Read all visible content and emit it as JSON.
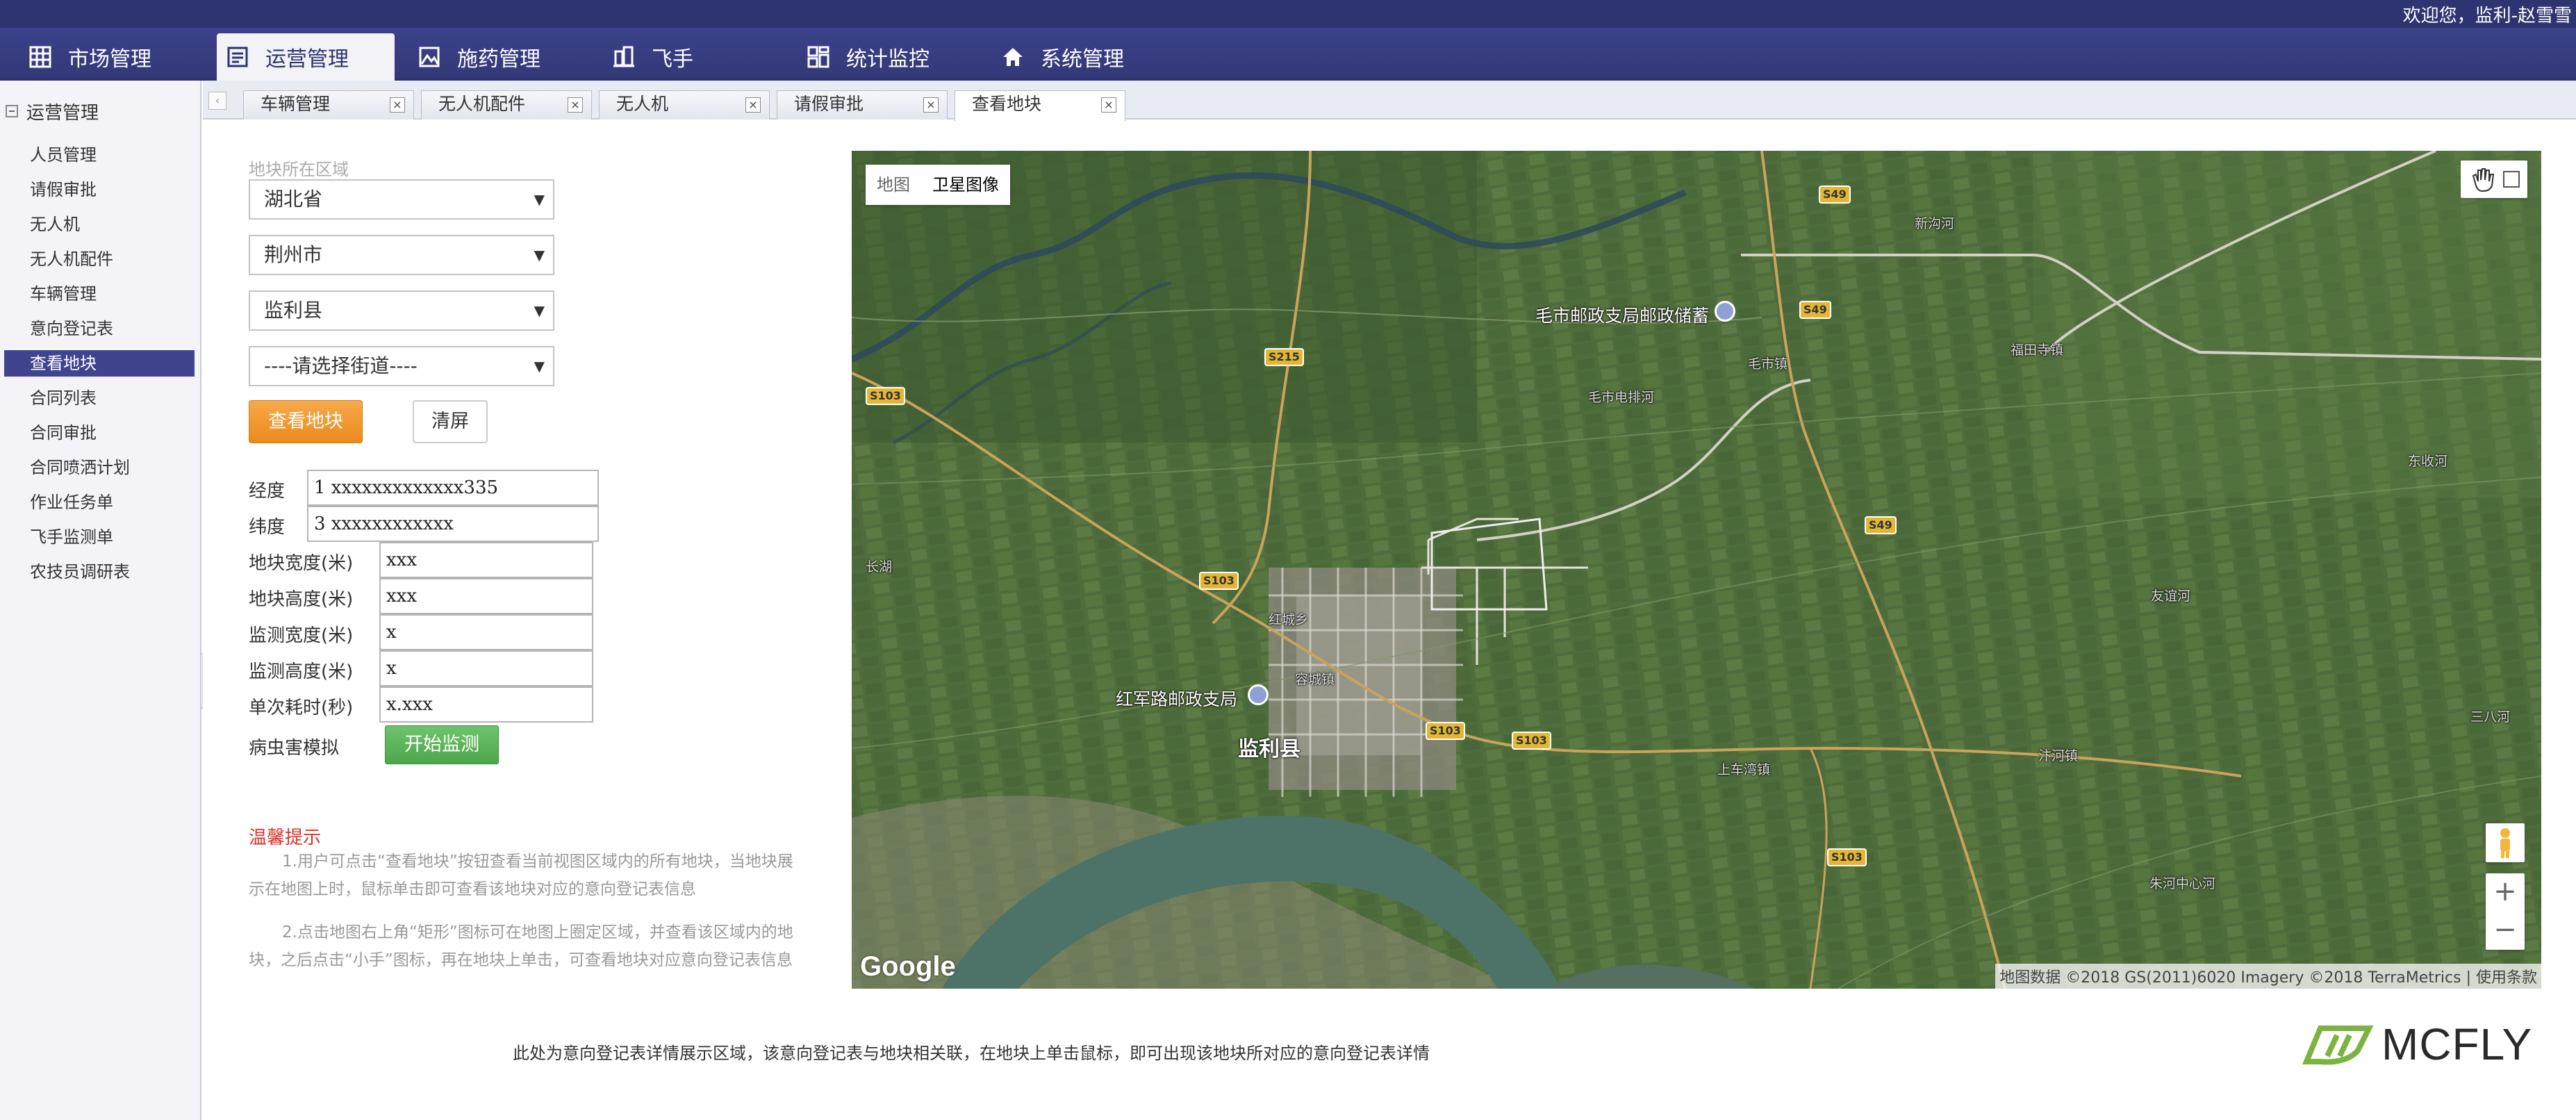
{
  "header": {
    "welcome": "欢迎您，监利-赵雪雪"
  },
  "nav": {
    "items": [
      {
        "label": "市场管理",
        "icon": "grid-icon"
      },
      {
        "label": "运营管理",
        "icon": "document-icon",
        "active": true
      },
      {
        "label": "施药管理",
        "icon": "image-icon"
      },
      {
        "label": "飞手",
        "icon": "building-icon"
      },
      {
        "label": "统计监控",
        "icon": "dashboard-icon"
      },
      {
        "label": "系统管理",
        "icon": "home-icon"
      }
    ]
  },
  "sidebar": {
    "title": "运营管理",
    "items": [
      {
        "label": "人员管理"
      },
      {
        "label": "请假审批"
      },
      {
        "label": "无人机"
      },
      {
        "label": "无人机配件"
      },
      {
        "label": "车辆管理"
      },
      {
        "label": "意向登记表"
      },
      {
        "label": "查看地块",
        "active": true
      },
      {
        "label": "合同列表"
      },
      {
        "label": "合同审批"
      },
      {
        "label": "合同喷洒计划"
      },
      {
        "label": "作业任务单"
      },
      {
        "label": "飞手监测单"
      },
      {
        "label": "农技员调研表"
      }
    ]
  },
  "tabs": [
    {
      "label": "车辆管理"
    },
    {
      "label": "无人机配件"
    },
    {
      "label": "无人机"
    },
    {
      "label": "请假审批"
    },
    {
      "label": "查看地块",
      "active": true
    }
  ],
  "form": {
    "region_label": "地块所在区域",
    "province": "湖北省",
    "city": "荆州市",
    "county": "监利县",
    "street_placeholder": "----请选择街道----",
    "view_button": "查看地块",
    "clear_button": "清屏",
    "longitude_label": "经度",
    "longitude_value": "1 xxxxxxxxxxxxx335",
    "latitude_label": "纬度",
    "latitude_value": "3 xxxxxxxxxxxx",
    "plot_width_label": "地块宽度(米)",
    "plot_width_value": "xxx",
    "plot_height_label": "地块高度(米)",
    "plot_height_value": "xxx",
    "monitor_width_label": "监测宽度(米)",
    "monitor_width_value": "x",
    "monitor_height_label": "监测高度(米)",
    "monitor_height_value": "x",
    "single_time_label": "单次耗时(秒)",
    "single_time_value": "x.xxx",
    "pest_label": "病虫害模拟",
    "start_button": "开始监测"
  },
  "tips": {
    "title": "温馨提示",
    "tip1": "1.用户可点击“查看地块”按钮查看当前视图区域内的所有地块，当地块展示在地图上时，鼠标单击即可查看该地块对应的意向登记表信息",
    "tip2": "2.点击地图右上角“矩形”图标可在地图上圈定区域，并查看该区域内的地块，之后点击“小手”图标，再在地块上单击，可查看地块对应意向登记表信息"
  },
  "map": {
    "type_map": "地图",
    "type_satellite": "卫星图像",
    "google": "Google",
    "attribution": "地图数据 ©2018 GS(2011)6020 Imagery ©2018 TerraMetrics | 使用条款",
    "zoom_in": "+",
    "zoom_out": "−",
    "labels": {
      "county": "监利县",
      "post1": "毛市邮政支局邮政储蓄",
      "post2": "红军路邮政支局",
      "maoshi": "毛市镇",
      "fushi": "福田寺镇",
      "hongcheng": "红城乡",
      "rongcheng": "容城镇",
      "shangche": "上车湾镇",
      "fenhe": "汴河镇",
      "zhuhe": "朱河中心河",
      "sanba": "三八河",
      "maoshidian": "毛市电排河",
      "dongjia": "东收河",
      "youju": "友谊河",
      "xinkou": "新沟河",
      "changhu": "长湖"
    },
    "shields": [
      "S49",
      "S49",
      "S49",
      "S215",
      "S103",
      "S103",
      "S103",
      "S103",
      "S103"
    ]
  },
  "footer": {
    "note": "此处为意向登记表详情展示区域，该意向登记表与地块相关联，在地块上单击鼠标，即可出现该地块所对应的意向登记表详情"
  },
  "logo": {
    "text": "MCFLY"
  }
}
